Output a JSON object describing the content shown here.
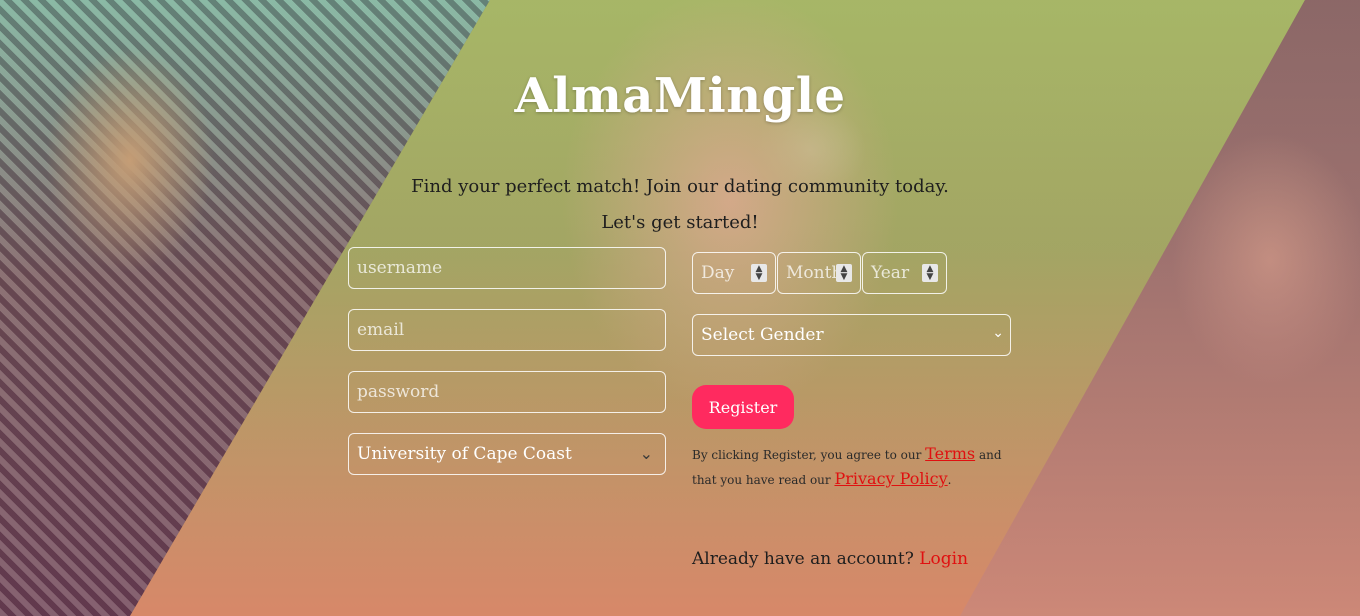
{
  "brand": {
    "title": "AlmaMingle"
  },
  "hero": {
    "tagline": "Find your perfect match! Join our dating community today.",
    "subline": "Let's get started!"
  },
  "form": {
    "username_placeholder": "username",
    "email_placeholder": "email",
    "password_placeholder": "password",
    "school_value": "University of Cape Coast",
    "day_placeholder": "Day",
    "month_placeholder": "Month",
    "year_placeholder": "Year",
    "gender_value": "Select Gender",
    "register_label": "Register"
  },
  "terms": {
    "prefix": "By clicking Register, you agree to our",
    "terms_link": "Terms",
    "middle": "and that you have read our",
    "privacy_link": "Privacy Policy",
    "suffix": "."
  },
  "login": {
    "prompt": "Already have an account?",
    "link": "Login"
  },
  "colors": {
    "accent": "#ff2a5f",
    "link": "#e01010"
  }
}
